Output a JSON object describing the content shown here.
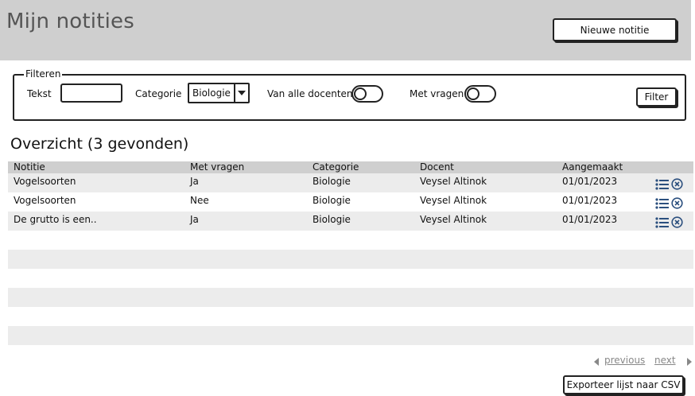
{
  "header": {
    "title": "Mijn notities",
    "new_button": "Nieuwe notitie"
  },
  "filter": {
    "legend": "Filteren",
    "text_label": "Tekst",
    "text_value": "",
    "category_label": "Categorie",
    "category_value": "Biologie",
    "all_teachers_label": "Van alle docenten",
    "all_teachers_on": false,
    "with_questions_label": "Met vragen",
    "with_questions_on": false,
    "filter_button": "Filter"
  },
  "overview": {
    "title": "Overzicht (3 gevonden)"
  },
  "table": {
    "columns": [
      "Notitie",
      "Met vragen",
      "Categorie",
      "Docent",
      "Aangemaakt"
    ],
    "rows": [
      [
        "Vogelsoorten",
        "Ja",
        "Biologie",
        "Veysel Altinok",
        "01/01/2023"
      ],
      [
        "Vogelsoorten",
        "Nee",
        "Biologie",
        "Veysel Altinok",
        "01/01/2023"
      ],
      [
        "De grutto is een..",
        "Ja",
        "Biologie",
        "Veysel Altinok",
        "01/01/2023"
      ]
    ]
  },
  "pagination": {
    "previous": "previous",
    "next": "next"
  },
  "export_button": "Exporteer lijst naar CSV",
  "colors": {
    "header_bg": "#cfcfcf",
    "icon_blue": "#2b4f7e",
    "row_alt": "#ececec"
  }
}
